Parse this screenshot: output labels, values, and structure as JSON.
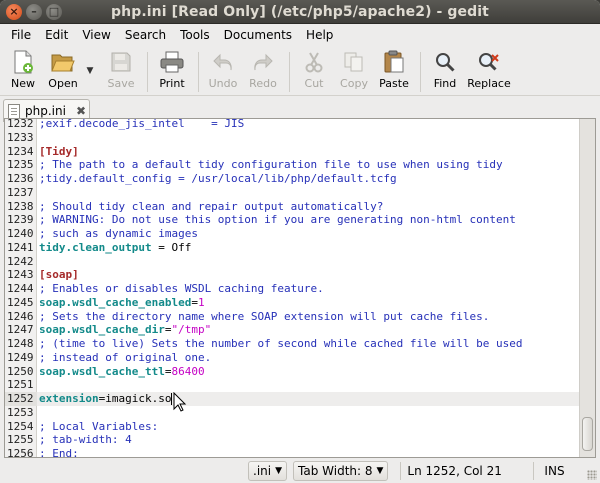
{
  "window": {
    "title": "php.ini [Read Only] (/etc/php5/apache2) - gedit",
    "buttons": {
      "close": "×",
      "minimize": "–",
      "maximize": "□"
    }
  },
  "menu": [
    "File",
    "Edit",
    "View",
    "Search",
    "Tools",
    "Documents",
    "Help"
  ],
  "toolbar": {
    "new": "New",
    "open": "Open",
    "save": "Save",
    "print": "Print",
    "undo": "Undo",
    "redo": "Redo",
    "cut": "Cut",
    "copy": "Copy",
    "paste": "Paste",
    "find": "Find",
    "replace": "Replace"
  },
  "tab": {
    "label": "php.ini",
    "close": "✖"
  },
  "editor": {
    "lines": [
      {
        "n": "1232",
        "parts": [
          [
            "c-blue",
            ";exif.decode_jis_intel    = JIS"
          ]
        ]
      },
      {
        "n": "1233",
        "parts": []
      },
      {
        "n": "1234",
        "parts": [
          [
            "c-brown",
            "[Tidy]"
          ]
        ]
      },
      {
        "n": "1235",
        "parts": [
          [
            "c-blue",
            "; The path to a default tidy configuration file to use when using tidy"
          ]
        ]
      },
      {
        "n": "1236",
        "parts": [
          [
            "c-blue",
            ";tidy.default_config = /usr/local/lib/php/default.tcfg"
          ]
        ]
      },
      {
        "n": "1237",
        "parts": []
      },
      {
        "n": "1238",
        "parts": [
          [
            "c-blue",
            "; Should tidy clean and repair output automatically?"
          ]
        ]
      },
      {
        "n": "1239",
        "parts": [
          [
            "c-blue",
            "; WARNING: Do not use this option if you are generating non-html content"
          ]
        ]
      },
      {
        "n": "1240",
        "parts": [
          [
            "c-blue",
            "; such as dynamic images"
          ]
        ]
      },
      {
        "n": "1241",
        "parts": [
          [
            "c-teal",
            "tidy.clean_output"
          ],
          [
            "c-black",
            " = Off"
          ]
        ]
      },
      {
        "n": "1242",
        "parts": []
      },
      {
        "n": "1243",
        "parts": [
          [
            "c-brown",
            "[soap]"
          ]
        ]
      },
      {
        "n": "1244",
        "parts": [
          [
            "c-blue",
            "; Enables or disables WSDL caching feature."
          ]
        ]
      },
      {
        "n": "1245",
        "parts": [
          [
            "c-teal",
            "soap.wsdl_cache_enabled"
          ],
          [
            "c-black",
            "="
          ],
          [
            "c-magenta",
            "1"
          ]
        ]
      },
      {
        "n": "1246",
        "parts": [
          [
            "c-blue",
            "; Sets the directory name where SOAP extension will put cache files."
          ]
        ]
      },
      {
        "n": "1247",
        "parts": [
          [
            "c-teal",
            "soap.wsdl_cache_dir"
          ],
          [
            "c-black",
            "="
          ],
          [
            "c-magenta",
            "\"/tmp\""
          ]
        ]
      },
      {
        "n": "1248",
        "parts": [
          [
            "c-blue",
            "; (time to live) Sets the number of second while cached file will be used"
          ]
        ]
      },
      {
        "n": "1249",
        "parts": [
          [
            "c-blue",
            "; instead of original one."
          ]
        ]
      },
      {
        "n": "1250",
        "parts": [
          [
            "c-teal",
            "soap.wsdl_cache_ttl"
          ],
          [
            "c-black",
            "="
          ],
          [
            "c-magenta",
            "86400"
          ]
        ]
      },
      {
        "n": "1251",
        "parts": []
      },
      {
        "n": "1252",
        "current": true,
        "parts": [
          [
            "c-teal",
            "extension"
          ],
          [
            "c-black",
            "=imagick.so"
          ]
        ]
      },
      {
        "n": "1253",
        "parts": []
      },
      {
        "n": "1254",
        "parts": [
          [
            "c-blue",
            "; Local Variables:"
          ]
        ]
      },
      {
        "n": "1255",
        "parts": [
          [
            "c-blue",
            "; tab-width: 4"
          ]
        ]
      },
      {
        "n": "1256",
        "parts": [
          [
            "c-blue",
            "; End:"
          ]
        ]
      }
    ]
  },
  "statusbar": {
    "language": ".ini",
    "tab_width": "Tab Width: 8",
    "position": "Ln 1252, Col 21",
    "mode": "INS"
  },
  "colors": {
    "comment": "#2630b8",
    "section": "#a52a2a",
    "key": "#138a8a",
    "value": "#c400c4",
    "titlebar": "#3c3b37"
  }
}
